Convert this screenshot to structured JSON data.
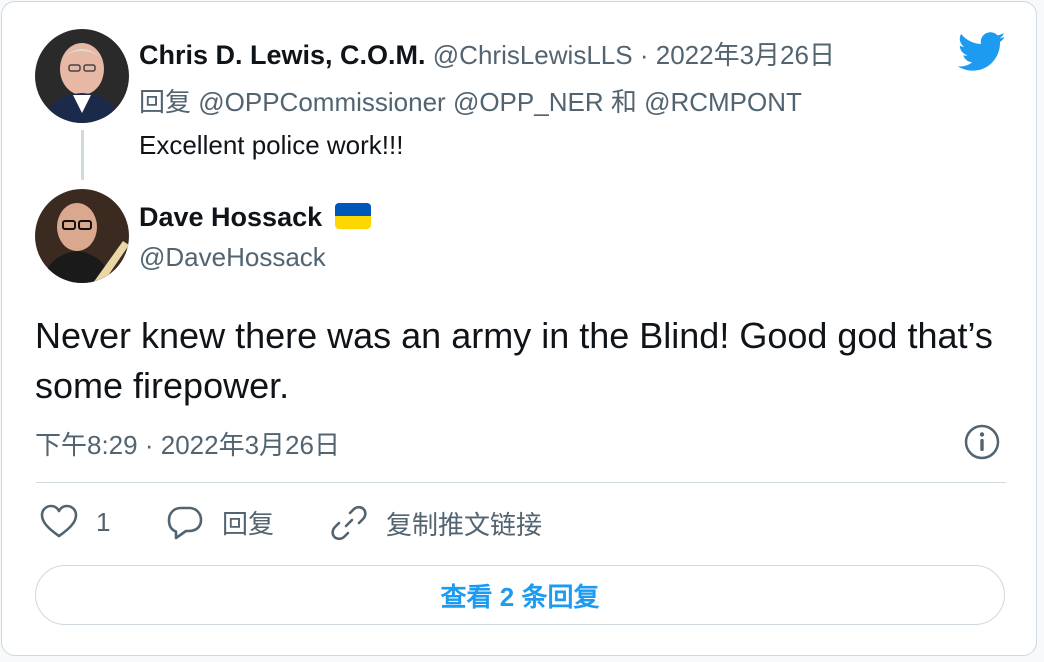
{
  "parent_tweet": {
    "display_name": "Chris D. Lewis, C.O.M.",
    "handle": "@ChrisLewisLLS",
    "separator": "·",
    "date": "2022年3月26日",
    "reply_prefix": "回复",
    "reply_mentions": [
      "@OPPCommissioner",
      "@OPP_NER",
      "@RCMPONT"
    ],
    "reply_joiner": "和",
    "text": "Excellent police work!!!"
  },
  "main_tweet": {
    "display_name": "Dave Hossack",
    "handle": "@DaveHossack",
    "flag": "ukraine-flag",
    "text": "Never knew there was an army in the Blind! Good god that’s some firepower.",
    "time": "下午8:29",
    "separator": "·",
    "date": "2022年3月26日"
  },
  "actions": {
    "like_count": "1",
    "reply_label": "回复",
    "copy_link_label": "复制推文链接"
  },
  "view_replies_label": "查看 2 条回复",
  "colors": {
    "accent": "#1d9bf0",
    "muted": "#536471",
    "text": "#0f1419",
    "border": "#cfd9de",
    "twitter_logo": "#1d9bf0"
  },
  "icons": [
    "twitter-bird-icon",
    "heart-icon",
    "reply-bubble-icon",
    "link-icon",
    "info-icon"
  ]
}
